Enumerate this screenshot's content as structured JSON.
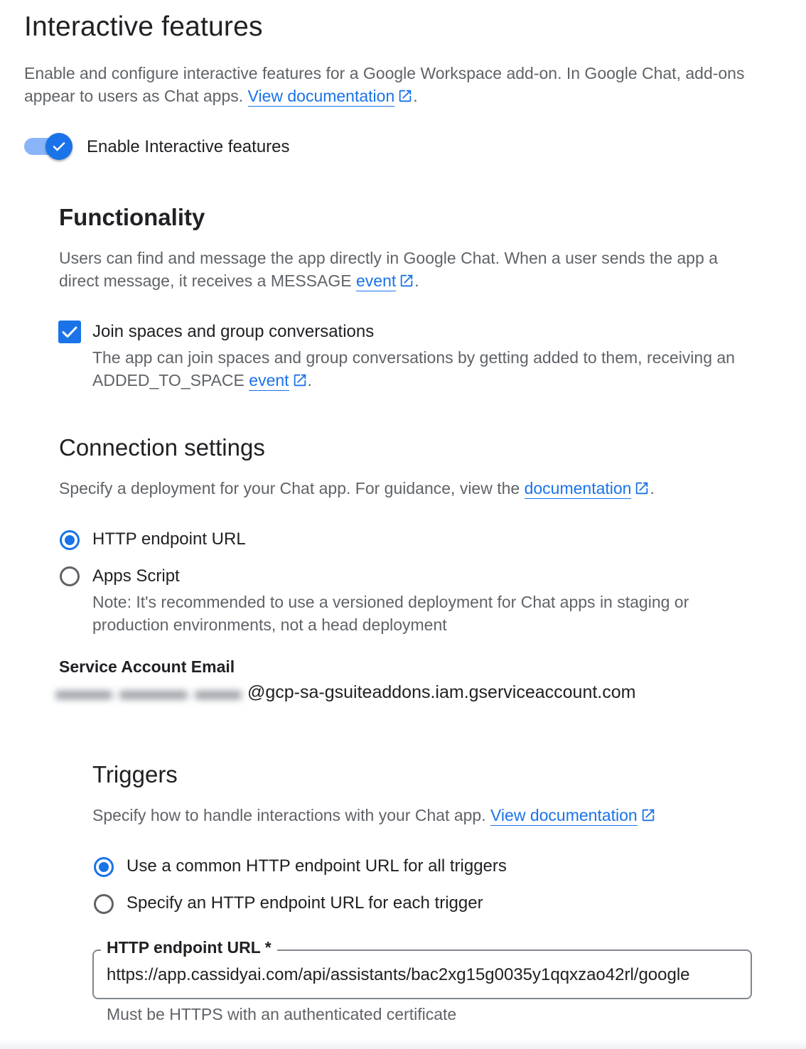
{
  "header": {
    "title": "Interactive features",
    "description": "Enable and configure interactive features for a Google Workspace add-on. In Google Chat, add-ons appear to users as Chat apps.",
    "doc_link": "View documentation",
    "period": "."
  },
  "toggle": {
    "label": "Enable Interactive features",
    "checked": true
  },
  "functionality": {
    "title": "Functionality",
    "description": "Users can find and message the app directly in Google Chat. When a user sends the app a direct message, it receives a MESSAGE",
    "event_link": "event",
    "period": ".",
    "join_spaces": {
      "label": "Join spaces and group conversations",
      "checked": true,
      "description": "The app can join spaces and group conversations by getting added to them, receiving an ADDED_TO_SPACE",
      "event_link": "event",
      "period": "."
    }
  },
  "connection": {
    "title": "Connection settings",
    "description": "Specify a deployment for your Chat app. For guidance, view the",
    "doc_link": "documentation",
    "period": ".",
    "options": [
      {
        "label": "HTTP endpoint URL",
        "selected": true
      },
      {
        "label": "Apps Script",
        "selected": false
      }
    ],
    "apps_script_note": "Note: It's recommended to use a versioned deployment for Chat apps in staging or production environments, not a head deployment"
  },
  "service_account": {
    "label": "Service Account Email",
    "domain": "@gcp-sa-gsuiteaddons.iam.gserviceaccount.com"
  },
  "triggers": {
    "title": "Triggers",
    "description": "Specify how to handle interactions with your Chat app.",
    "doc_link": "View documentation",
    "options": [
      {
        "label": "Use a common HTTP endpoint URL for all triggers",
        "selected": true
      },
      {
        "label": "Specify an HTTP endpoint URL for each trigger",
        "selected": false
      }
    ],
    "url_field": {
      "label": "HTTP endpoint URL *",
      "value": "https://app.cassidyai.com/api/assistants/bac2xg15g0035y1qqxzao42rl/google",
      "hint": "Must be HTTPS with an authenticated certificate"
    }
  },
  "icons": {
    "external_link": "open-in-new-icon",
    "check": "check-icon"
  },
  "colors": {
    "accent": "#1a73e8",
    "text": "#202124",
    "secondary_text": "#5f6368",
    "toggle_track": "#8ab4f8"
  }
}
